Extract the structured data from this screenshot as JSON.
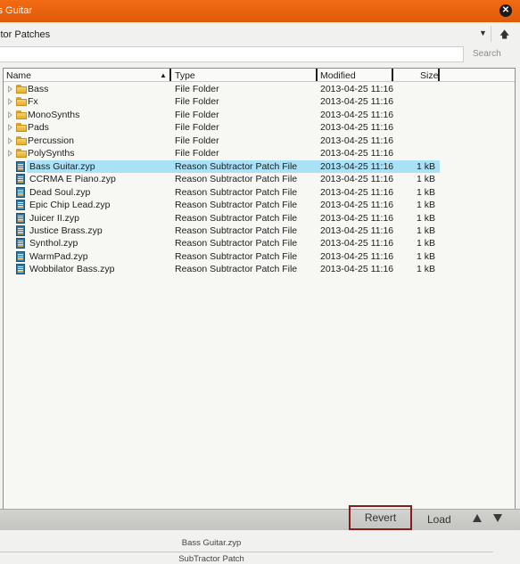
{
  "window": {
    "title": "ss Guitar",
    "close_icon": "close-icon"
  },
  "location": {
    "path": "ctor Patches"
  },
  "search": {
    "value": "",
    "button_label": "Search"
  },
  "columns": {
    "name": "Name",
    "type": "Type",
    "modified": "Modified",
    "size": "Size"
  },
  "rows": [
    {
      "kind": "folder",
      "name": "Bass",
      "type": "File Folder",
      "modified": "2013-04-25 11:16",
      "size": ""
    },
    {
      "kind": "folder",
      "name": "Fx",
      "type": "File Folder",
      "modified": "2013-04-25 11:16",
      "size": ""
    },
    {
      "kind": "folder",
      "name": "MonoSynths",
      "type": "File Folder",
      "modified": "2013-04-25 11:16",
      "size": ""
    },
    {
      "kind": "folder",
      "name": "Pads",
      "type": "File Folder",
      "modified": "2013-04-25 11:16",
      "size": ""
    },
    {
      "kind": "folder",
      "name": "Percussion",
      "type": "File Folder",
      "modified": "2013-04-25 11:16",
      "size": ""
    },
    {
      "kind": "folder",
      "name": "PolySynths",
      "type": "File Folder",
      "modified": "2013-04-25 11:16",
      "size": ""
    },
    {
      "kind": "file",
      "selected": true,
      "name": "Bass Guitar.zyp",
      "type": "Reason Subtractor Patch File",
      "modified": "2013-04-25 11:16",
      "size": "1 kB"
    },
    {
      "kind": "file",
      "name": "CCRMA E Piano.zyp",
      "type": "Reason Subtractor Patch File",
      "modified": "2013-04-25 11:16",
      "size": "1 kB"
    },
    {
      "kind": "file",
      "name": "Dead Soul.zyp",
      "type": "Reason Subtractor Patch File",
      "modified": "2013-04-25 11:16",
      "size": "1 kB"
    },
    {
      "kind": "file",
      "name": "Epic Chip Lead.zyp",
      "type": "Reason Subtractor Patch File",
      "modified": "2013-04-25 11:16",
      "size": "1 kB"
    },
    {
      "kind": "file",
      "name": "Juicer II.zyp",
      "type": "Reason Subtractor Patch File",
      "modified": "2013-04-25 11:16",
      "size": "1 kB"
    },
    {
      "kind": "file",
      "name": "Justice Brass.zyp",
      "type": "Reason Subtractor Patch File",
      "modified": "2013-04-25 11:16",
      "size": "1 kB"
    },
    {
      "kind": "file",
      "name": "Synthol.zyp",
      "type": "Reason Subtractor Patch File",
      "modified": "2013-04-25 11:16",
      "size": "1 kB"
    },
    {
      "kind": "file",
      "name": "WarmPad.zyp",
      "type": "Reason Subtractor Patch File",
      "modified": "2013-04-25 11:16",
      "size": "1 kB"
    },
    {
      "kind": "file",
      "name": "Wobbilator Bass.zyp",
      "type": "Reason Subtractor Patch File",
      "modified": "2013-04-25 11:16",
      "size": "1 kB"
    }
  ],
  "toolbar": {
    "revert_label": "Revert",
    "load_label": "Load"
  },
  "info": {
    "filename": "Bass Guitar.zyp",
    "patch_type": "SubTractor Patch"
  },
  "colors": {
    "titlebar": "#e8620c",
    "selection": "#a9e1f6",
    "revert_border": "#8b1a1a"
  }
}
